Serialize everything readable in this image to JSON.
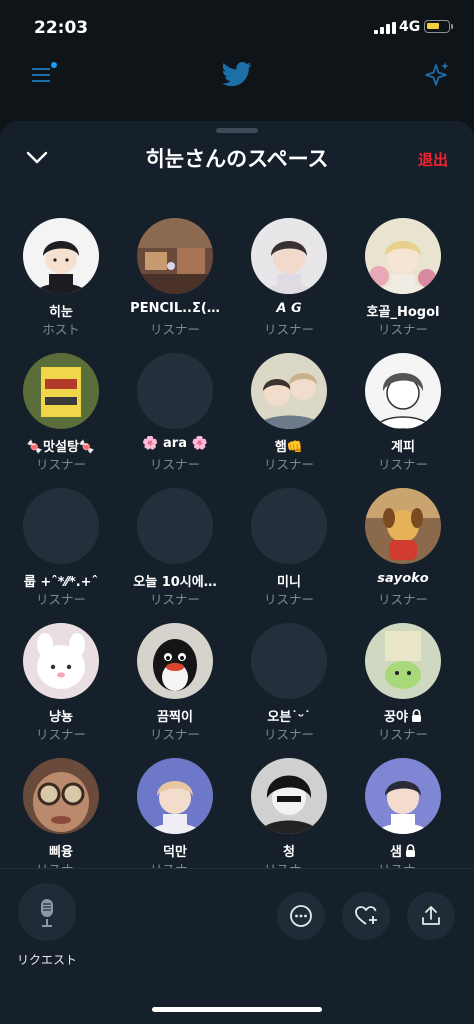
{
  "status_bar": {
    "time": "22:03",
    "network": "4G"
  },
  "space": {
    "title": "히눈さんのスペース",
    "exit_label": "退出"
  },
  "participants": [
    {
      "name": "히눈",
      "role": "ホスト",
      "avatar": "boy-black-hair"
    },
    {
      "name": "PENCIL..Σ(…",
      "role": "リスナー",
      "avatar": "room-photo"
    },
    {
      "name": "𝘼 𝙂",
      "role": "リスナー",
      "avatar": "dark-hair-man"
    },
    {
      "name": "호골_Hogol",
      "role": "リスナー",
      "avatar": "blonde-flowers"
    },
    {
      "name": "🍬맛설탕🍬",
      "role": "リスナー",
      "avatar": "sign-photo"
    },
    {
      "name": "🌸 ara 🌸",
      "role": "リスナー",
      "avatar": "default"
    },
    {
      "name": "햄👊",
      "role": "リスナー",
      "avatar": "two-men-art"
    },
    {
      "name": "계피",
      "role": "リスナー",
      "avatar": "sketch-boy"
    },
    {
      "name": "룹 +ˆ*⁄⁄*.+ˆ",
      "role": "リスナー",
      "avatar": "default"
    },
    {
      "name": "오늘 10시에…",
      "role": "リスナー",
      "avatar": "default"
    },
    {
      "name": "미니",
      "role": "リスナー",
      "avatar": "default"
    },
    {
      "name": "𝙨𝙖𝙮𝙤𝙠𝙤",
      "role": "リスナー",
      "avatar": "plush-dog"
    },
    {
      "name": "냥뇽",
      "role": "リスナー",
      "avatar": "white-plush"
    },
    {
      "name": "끔찍이",
      "role": "リスナー",
      "avatar": "pingu"
    },
    {
      "name": "오븐˙ᵕ˙",
      "role": "リスナー",
      "avatar": "default"
    },
    {
      "name": "꿍야",
      "role": "リスナー",
      "avatar": "cartoon-bread",
      "locked": true
    },
    {
      "name": "삐융",
      "role": "リスナー",
      "avatar": "glasses-photo"
    },
    {
      "name": "덕만",
      "role": "リスナー",
      "avatar": "blonde-anime"
    },
    {
      "name": "청",
      "role": "リスナー",
      "avatar": "bw-manga"
    },
    {
      "name": "샘",
      "role": "リスナー",
      "avatar": "dark-anime",
      "locked": true
    }
  ],
  "bottom_bar": {
    "request_label": "リクエスト",
    "buttons": [
      "more-icon",
      "heart-plus-icon",
      "share-icon"
    ]
  },
  "colors": {
    "accent": "#1d9bf0",
    "exit": "#f4212e",
    "background": "#16202b"
  }
}
